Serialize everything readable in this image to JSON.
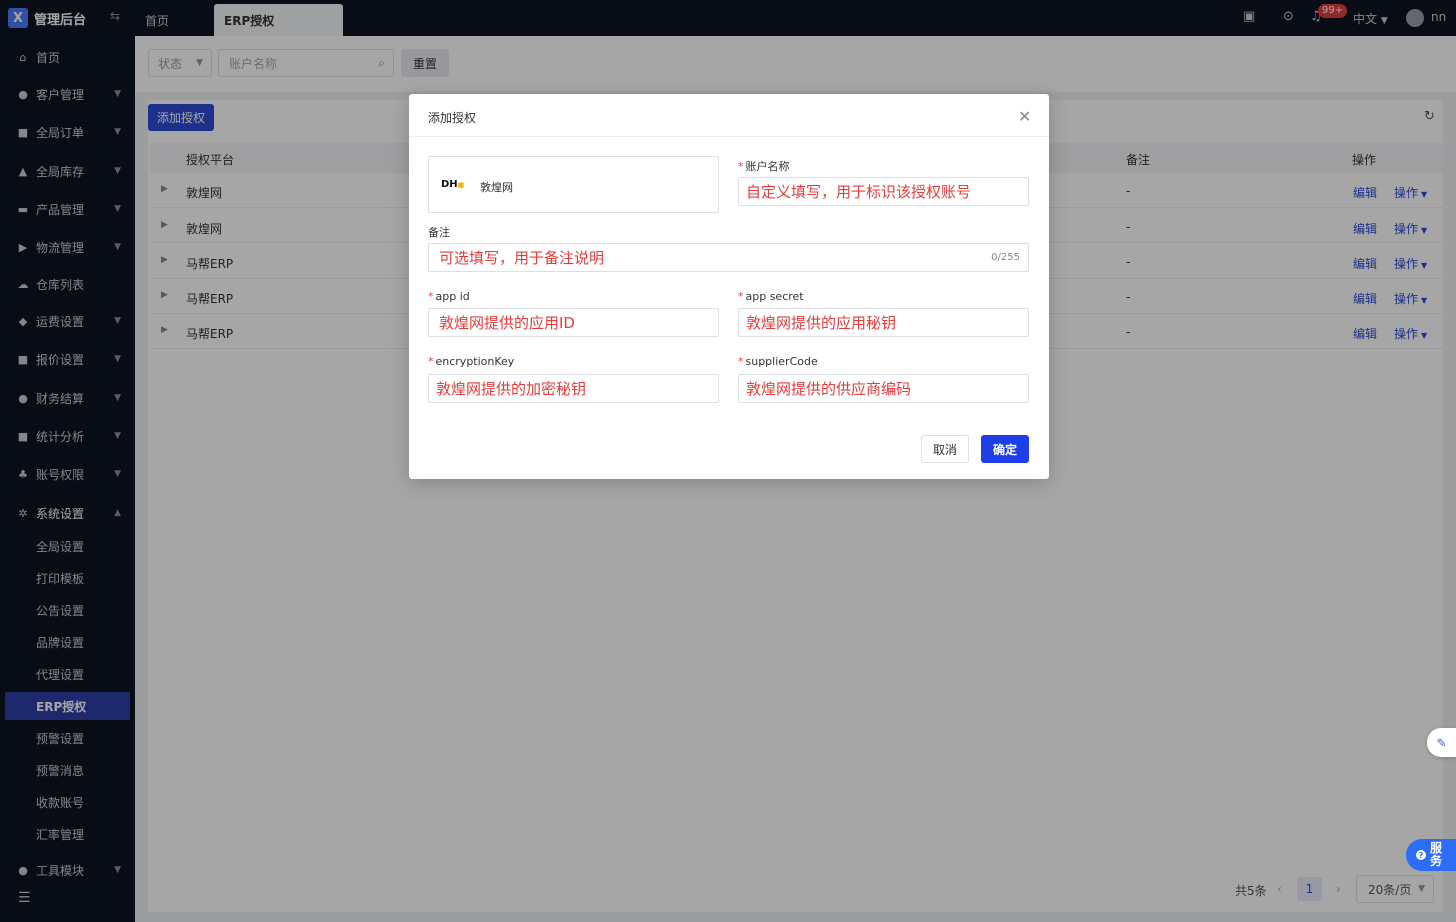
{
  "app": {
    "title": "管理后台"
  },
  "sidebar": {
    "items": [
      {
        "label": "首页",
        "icon": "home-icon"
      },
      {
        "label": "客户管理",
        "icon": "users-icon"
      },
      {
        "label": "全局订单",
        "icon": "order-icon"
      },
      {
        "label": "全局库存",
        "icon": "warehouse-icon"
      },
      {
        "label": "产品管理",
        "icon": "product-icon"
      },
      {
        "label": "物流管理",
        "icon": "truck-icon"
      },
      {
        "label": "仓库列表",
        "icon": "cloud-icon"
      },
      {
        "label": "运费设置",
        "icon": "shipping-icon"
      },
      {
        "label": "报价设置",
        "icon": "quote-icon"
      },
      {
        "label": "财务结算",
        "icon": "finance-icon"
      },
      {
        "label": "统计分析",
        "icon": "stats-icon"
      },
      {
        "label": "账号权限",
        "icon": "org-icon"
      },
      {
        "label": "系统设置",
        "icon": "settings-icon"
      },
      {
        "label": "工具模块",
        "icon": "tool-icon"
      }
    ],
    "sub_items": [
      {
        "label": "全局设置"
      },
      {
        "label": "打印模板"
      },
      {
        "label": "公告设置"
      },
      {
        "label": "品牌设置"
      },
      {
        "label": "代理设置"
      },
      {
        "label": "ERP授权"
      },
      {
        "label": "预警设置"
      },
      {
        "label": "预警消息"
      },
      {
        "label": "收款账号"
      },
      {
        "label": "汇率管理"
      }
    ]
  },
  "tabs": [
    {
      "label": "首页"
    },
    {
      "label": "ERP授权"
    }
  ],
  "header": {
    "notification_badge": "99+",
    "language": "中文",
    "username": "nn"
  },
  "filters": {
    "status_placeholder": "状态",
    "account_placeholder": "账户名称",
    "reset_label": "重置"
  },
  "toolbar": {
    "add_label": "添加授权"
  },
  "table": {
    "columns": [
      "授权平台",
      "备注",
      "操作"
    ],
    "rows": [
      {
        "platform": "敦煌网",
        "remark": "-",
        "edit": "编辑",
        "ops": "操作"
      },
      {
        "platform": "敦煌网",
        "remark": "-",
        "edit": "编辑",
        "ops": "操作"
      },
      {
        "platform": "马帮ERP",
        "remark": "-",
        "edit": "编辑",
        "ops": "操作"
      },
      {
        "platform": "马帮ERP",
        "remark": "-",
        "edit": "编辑",
        "ops": "操作"
      },
      {
        "platform": "马帮ERP",
        "remark": "-",
        "edit": "编辑",
        "ops": "操作"
      }
    ]
  },
  "pagination": {
    "total": "共5条",
    "current_page": "1",
    "page_size": "20条/页"
  },
  "modal": {
    "title": "添加授权",
    "platform": {
      "logo_text_dark": "DH",
      "logo_text_accent": "⬛",
      "name": "敦煌网"
    },
    "account_name": {
      "label": "账户名称",
      "value": "自定义填写，用于标识该授权账号"
    },
    "remark": {
      "label": "备注",
      "value": "可选填写，用于备注说明",
      "count": "0/255"
    },
    "app_id": {
      "label": "app id",
      "value": "敦煌网提供的应用ID"
    },
    "app_secret": {
      "label": "app secret",
      "value": "敦煌网提供的应用秘钥"
    },
    "encryption_key": {
      "label": "encryptionKey",
      "value": "敦煌网提供的加密秘钥"
    },
    "supplier_code": {
      "label": "supplierCode",
      "value": "敦煌网提供的供应商编码"
    },
    "cancel_label": "取消",
    "confirm_label": "确定"
  },
  "widgets": {
    "service_label": "服务"
  },
  "colors": {
    "primary": "#2d4bd6",
    "sidebar_bg": "#0d1421",
    "required": "#e23d3d"
  }
}
